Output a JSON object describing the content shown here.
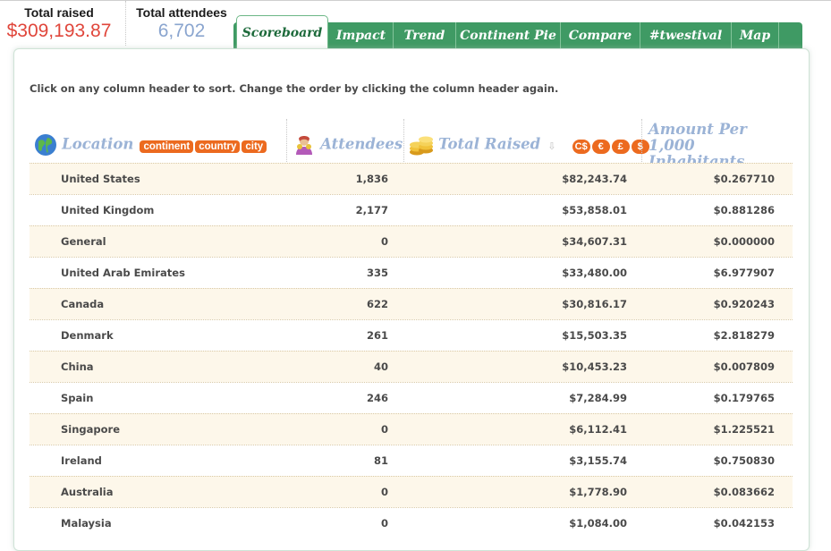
{
  "header": {
    "total_raised_label": "Total raised",
    "total_raised_value": "$309,193.87",
    "total_attendees_label": "Total attendees",
    "total_attendees_value": "6,702"
  },
  "tabs": [
    {
      "label": "Scoreboard",
      "active": true
    },
    {
      "label": "Impact",
      "active": false
    },
    {
      "label": "Trend",
      "active": false
    },
    {
      "label": "Continent Pie",
      "active": false
    },
    {
      "label": "Compare",
      "active": false
    },
    {
      "label": "#twestival",
      "active": false
    },
    {
      "label": "Map",
      "active": false
    }
  ],
  "instructions": "Click on any column header to sort. Change the order by clicking the column header again.",
  "columns": {
    "location": {
      "title": "Location",
      "filters": [
        "continent",
        "country",
        "city"
      ],
      "icon": "globe-icon"
    },
    "attendees": {
      "title": "Attendees",
      "icon": "person-icon"
    },
    "total_raised": {
      "title": "Total Raised",
      "currencies": [
        "C$",
        "€",
        "£",
        "$"
      ],
      "icon": "coins-icon",
      "sort": "desc"
    },
    "amount_per": {
      "title_line1": "Amount Per 1,000",
      "title_line2": "Inhabitants"
    }
  },
  "rows": [
    {
      "location": "United States",
      "attendees": "1,836",
      "total": "$82,243.74",
      "per": "$0.267710"
    },
    {
      "location": "United Kingdom",
      "attendees": "2,177",
      "total": "$53,858.01",
      "per": "$0.881286"
    },
    {
      "location": "General",
      "attendees": "0",
      "total": "$34,607.31",
      "per": "$0.000000"
    },
    {
      "location": "United Arab Emirates",
      "attendees": "335",
      "total": "$33,480.00",
      "per": "$6.977907"
    },
    {
      "location": "Canada",
      "attendees": "622",
      "total": "$30,816.17",
      "per": "$0.920243"
    },
    {
      "location": "Denmark",
      "attendees": "261",
      "total": "$15,503.35",
      "per": "$2.818279"
    },
    {
      "location": "China",
      "attendees": "40",
      "total": "$10,453.23",
      "per": "$0.007809"
    },
    {
      "location": "Spain",
      "attendees": "246",
      "total": "$7,284.99",
      "per": "$0.179765"
    },
    {
      "location": "Singapore",
      "attendees": "0",
      "total": "$6,112.41",
      "per": "$1.225521"
    },
    {
      "location": "Ireland",
      "attendees": "81",
      "total": "$3,155.74",
      "per": "$0.750830"
    },
    {
      "location": "Australia",
      "attendees": "0",
      "total": "$1,778.90",
      "per": "$0.083662"
    },
    {
      "location": "Malaysia",
      "attendees": "0",
      "total": "$1,084.00",
      "per": "$0.042153"
    }
  ],
  "colors": {
    "accent_green": "#3f9a64",
    "raised_red": "#e0463b",
    "attendees_blue": "#8aa5cf",
    "badge_orange": "#ec6a1f",
    "row_stripe": "#fdf7ea"
  }
}
